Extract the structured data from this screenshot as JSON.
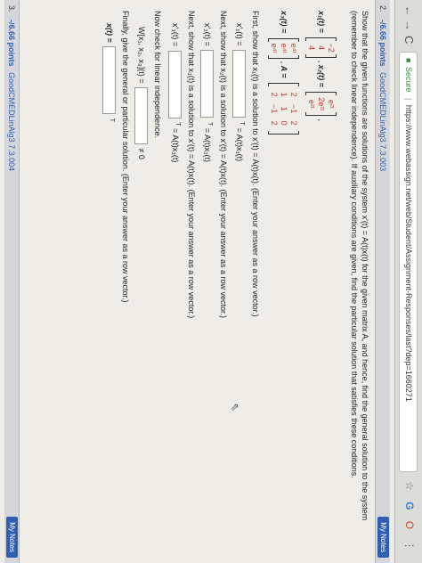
{
  "browser": {
    "back": "←",
    "forward": "→",
    "reload": "C",
    "secure_label": "Secure",
    "url": "https://www.webassign.net/web/Student/Assignment-Responses/last?dep=1660271",
    "star": "☆",
    "ext_g": "G",
    "ext_o": "O",
    "menu": "⋮"
  },
  "question": {
    "number": "2.",
    "points": "-/6.66 points",
    "source": "GoodCMEDLinAlg3 7.3.003",
    "notes_button": "My Notes",
    "prompt": "Show that the given functions are solutions of the system x′(t) = A(t)x(t) for the given matrix A, and hence, find the general solution to the system (remember to check linear independence). If auxiliary conditions are given, find the particular solution that satisfies these conditions.",
    "x1_label": "x₁(t) =",
    "x1_entries": [
      "−2",
      "4",
      "4"
    ],
    "x2_label": "x₂(t) =",
    "x2_entries": [
      "e²ᵗ",
      "2e²ᵗ",
      "e²ᵗ"
    ],
    "x3_label": "x₃(t) =",
    "x3_entries": [
      "e⁴ᵗ",
      "e⁴ᵗ",
      "e⁴ᵗ"
    ],
    "A_label": "A =",
    "A_rows": [
      [
        "2",
        "−1",
        "2"
      ],
      [
        "1",
        "1",
        "0"
      ],
      [
        "2",
        "−1",
        "2"
      ]
    ],
    "first": "First, show that x₁(t) is a solution to x′(t) = A(t)x(t). (Enter your answer as a row vector.)",
    "x1p": "x′₁(t) =",
    "eqA1": "= A(t)x₁(t)",
    "next2": "Next, show that x₂(t) is a solution to x′(t) = A(t)x(t). (Enter your answer as a row vector.)",
    "x2p": "x′₂(t) =",
    "eqA2": "= A(t)x₂(t)",
    "next3": "Next, show that x₃(t) is a solution to x′(t) = A(t)x(t). (Enter your answer as a row vector.)",
    "x3p": "x′₃(t) =",
    "eqA3": "= A(t)x₃(t)",
    "independence": "Now check for linear independence.",
    "wronskian": "W[x₁, x₂, x₃](t) =",
    "neq": "≠ 0",
    "finally": "Finally, give the general or particular solution. (Enter your answer as a row vector.)",
    "xt": "x(t) =",
    "transpose": "T"
  },
  "footer": {
    "number": "3.",
    "points": "-/6.66 points",
    "source": "GoodCMEDLinAlg3 7.3.004",
    "notes_button": "My Notes"
  }
}
